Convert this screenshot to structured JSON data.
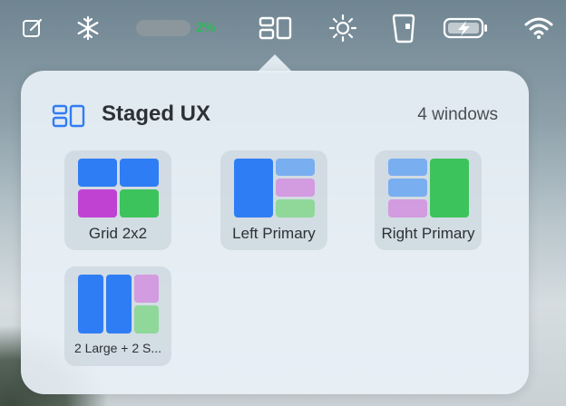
{
  "menubar": {
    "items": [
      "compose-icon",
      "snowflake-icon",
      "battery-widget",
      "staged-ux-icon",
      "brightness-icon",
      "phone-icon",
      "battery-charging-icon",
      "wifi-icon"
    ],
    "battery_percent": "2%"
  },
  "panel": {
    "title": "Staged UX",
    "window_count": "4 windows",
    "layouts": [
      {
        "label": "Grid 2x2"
      },
      {
        "label": "Left Primary"
      },
      {
        "label": "Right Primary"
      },
      {
        "label": "2 Large + 2 S..."
      }
    ]
  },
  "colors": {
    "accent_blue": "#2f7df4",
    "light_blue": "#79aef0",
    "purple": "#c042d3",
    "light_purple": "#d39be0",
    "green": "#3dc35c",
    "light_green": "#8fd89a",
    "battery_green": "#2fb85a"
  }
}
